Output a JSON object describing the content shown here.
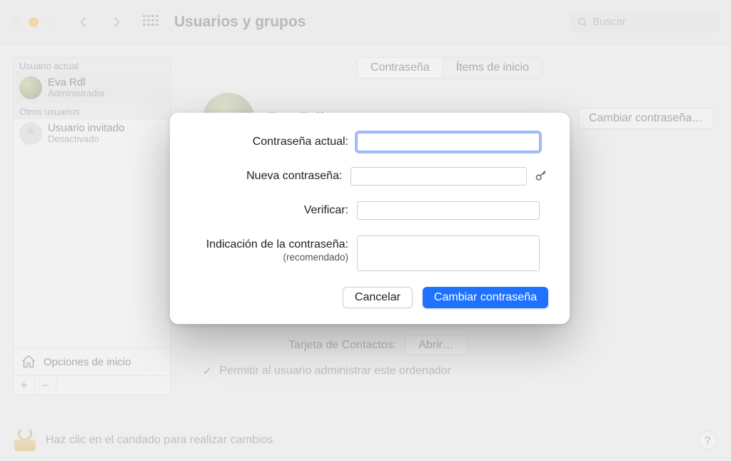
{
  "toolbar": {
    "title": "Usuarios y grupos",
    "search_placeholder": "Buscar"
  },
  "sidebar": {
    "current_user_header": "Usuario actual",
    "other_users_header": "Otros usuarios",
    "current_user": {
      "name": "Eva Rdl",
      "role": "Administrador"
    },
    "guest_user": {
      "name": "Usuario invitado",
      "role": "Desactivado"
    },
    "login_options_label": "Opciones de inicio"
  },
  "main": {
    "tab_password": "Contraseña",
    "tab_login_items": "Ítems de inicio",
    "display_name": "Eva Rdl",
    "change_password_btn": "Cambiar contraseña…",
    "contacts_label": "Tarjeta de Contactos:",
    "contacts_open_btn": "Abrir…",
    "admin_checkbox_label": "Permitir al usuario administrar este ordenador"
  },
  "footer": {
    "lock_hint": "Haz clic en el candado para realizar cambios",
    "help_label": "?"
  },
  "dialog": {
    "current_password_label": "Contraseña actual:",
    "new_password_label": "Nueva contraseña:",
    "verify_label": "Verificar:",
    "hint_label": "Indicación de la contraseña:",
    "hint_sub": "(recomendado)",
    "cancel_btn": "Cancelar",
    "submit_btn": "Cambiar contraseña",
    "values": {
      "current": "",
      "new": "",
      "verify": "",
      "hint": ""
    }
  }
}
